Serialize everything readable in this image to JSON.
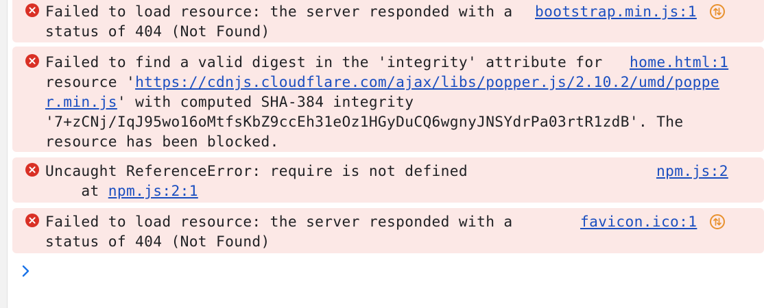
{
  "console": {
    "messages": [
      {
        "lines": [
          "Failed to load resource: the server responded with a",
          "status of 404 (Not Found)"
        ],
        "source": "bootstrap.min.js:1",
        "icon": "network-icon"
      },
      {
        "line1": "Failed to find a valid digest in the 'integrity' attribute for",
        "line2_pre": "resource '",
        "url_part1": "https://cdnjs.cloudflare.com/ajax/libs/popper.js/2.10.2/umd/poppe",
        "url_part2": "r.min.js",
        "line3_post": "' with computed SHA-384 integrity",
        "line4": "'7+zCNj/IqJ95wo16oMtfsKbZ9ccEh31eOz1HGyDuCQ6wgnyJNSYdrPa03rtR1zdB'. The",
        "line5": "resource has been blocked.",
        "source": "home.html:1"
      },
      {
        "line1": "Uncaught ReferenceError: require is not defined",
        "stack_prefix": "    at ",
        "stack_link": "npm.js:2:1",
        "source": "npm.js:2"
      },
      {
        "lines": [
          "Failed to load resource: the server responded with a",
          "status of 404 (Not Found)"
        ],
        "source": "favicon.ico:1",
        "icon": "network-icon"
      }
    ],
    "prompt_symbol": "›"
  },
  "colors": {
    "error_bg": "#fce8e6",
    "error_icon": "#d93025",
    "link": "#1a4ec0",
    "network_icon": "#e8912d",
    "prompt": "#1a73e8"
  }
}
